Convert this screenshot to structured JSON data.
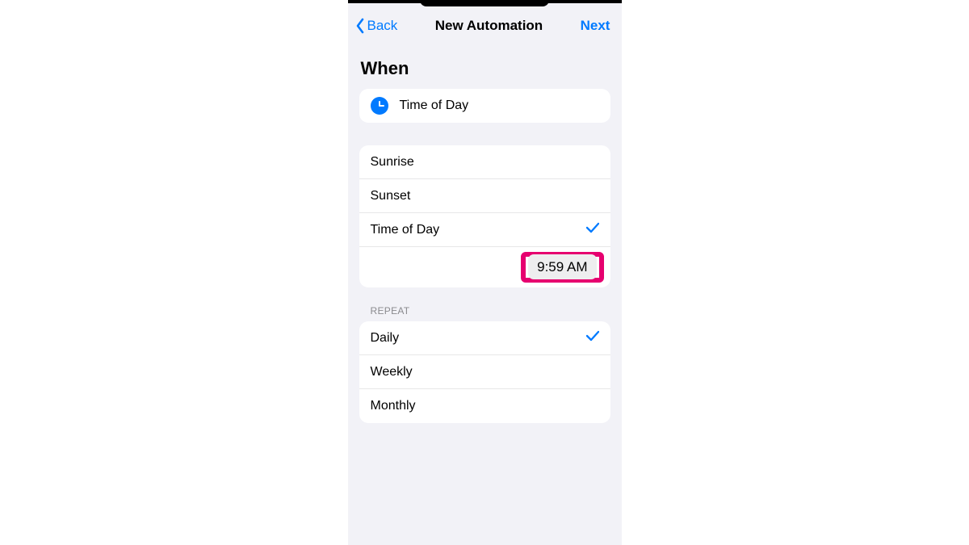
{
  "nav": {
    "back_label": "Back",
    "title": "New Automation",
    "next_label": "Next"
  },
  "when": {
    "heading": "When",
    "trigger_label": "Time of Day",
    "options": {
      "sunrise": "Sunrise",
      "sunset": "Sunset",
      "time_of_day": "Time of Day"
    },
    "selected_time": "9:59 AM"
  },
  "repeat": {
    "section_label": "REPEAT",
    "options": {
      "daily": "Daily",
      "weekly": "Weekly",
      "monthly": "Monthly"
    }
  }
}
